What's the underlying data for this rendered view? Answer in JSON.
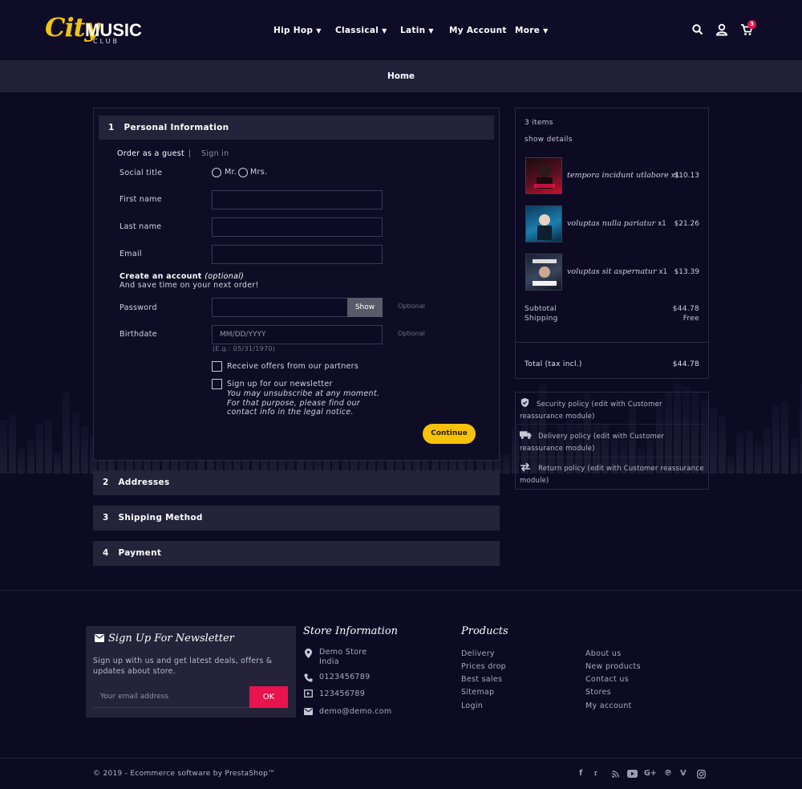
{
  "header": {
    "logo": {
      "city": "City",
      "music": "MUSIC",
      "club": "CLUB"
    },
    "nav": [
      {
        "label": "Hip Hop",
        "dropdown": true
      },
      {
        "label": "Classical",
        "dropdown": true
      },
      {
        "label": "Latin",
        "dropdown": true
      },
      {
        "label": "My Account",
        "dropdown": false
      },
      {
        "label": "More",
        "dropdown": true
      }
    ],
    "icons": [
      "search-icon",
      "user-icon",
      "cart-icon"
    ],
    "cart_count": "3",
    "accent_color": "#f6c30a",
    "badge_color": "#e8134f"
  },
  "breadcrumb": {
    "home": "Home"
  },
  "checkout": {
    "step1": {
      "number": "1",
      "title": "Personal Information",
      "guest_tab": "Order as a guest",
      "separator": "|",
      "signin_tab": "Sign in",
      "social_title_label": "Social title",
      "mr": "Mr.",
      "mrs": "Mrs.",
      "first_name_label": "First name",
      "last_name_label": "Last name",
      "email_label": "Email",
      "create_account": "Create an account",
      "create_optional": "(optional)",
      "save_time": "And save time on your next order!",
      "password_label": "Password",
      "show_button": "Show",
      "optional": "Optional",
      "birthdate_label": "Birthdate",
      "birthdate_placeholder": "MM/DD/YYYY",
      "birthdate_hint": "(E.g.: 05/31/1970)",
      "offers_label": "Receive offers from our partners",
      "newsletter_label": "Sign up for our newsletter",
      "newsletter_note": "You may unsubscribe at any moment. For that purpose, please find our contact info in the legal notice.",
      "continue_button": "Continue"
    },
    "steps": [
      {
        "number": "2",
        "title": "Addresses"
      },
      {
        "number": "3",
        "title": "Shipping Method"
      },
      {
        "number": "4",
        "title": "Payment"
      }
    ]
  },
  "summary": {
    "items_count": "3 items",
    "show_details": "show details",
    "products": [
      {
        "name": "tempora incidunt utlabore",
        "qty": "x1",
        "price": "$10.13"
      },
      {
        "name": "voluptas nulla pariatur",
        "qty": "x1",
        "price": "$21.26"
      },
      {
        "name": "voluptas sit aspernatur",
        "qty": "x1",
        "price": "$13.39"
      }
    ],
    "subtotal_label": "Subtotal",
    "subtotal_value": "$44.78",
    "shipping_label": "Shipping",
    "shipping_value": "Free",
    "total_label": "Total (tax incl.)",
    "total_value": "$44.78"
  },
  "reassurance": [
    {
      "icon": "shield-icon",
      "text": "Security policy (edit with Customer reassurance module)"
    },
    {
      "icon": "truck-icon",
      "text": "Delivery policy (edit with Customer reassurance module)"
    },
    {
      "icon": "swap-icon",
      "text": "Return policy (edit with Customer reassurance module)"
    }
  ],
  "footer": {
    "newsletter_title": "Sign Up For Newsletter",
    "newsletter_text": "Sign up with us and get latest deals, offers & updates about store.",
    "email_placeholder": "Your email address",
    "ok_button": "OK",
    "store_title": "Store Information",
    "store_name": "Demo Store",
    "store_country": "India",
    "phone": "0123456789",
    "fax": "123456789",
    "email": "demo@demo.com",
    "products_title": "Products",
    "products_links": [
      "Delivery",
      "Prices drop",
      "Best sales",
      "Sitemap",
      "Login"
    ],
    "company_links": [
      "About us",
      "New products",
      "Contact us",
      "Stores",
      "My account"
    ],
    "copyright": "© 2019 - Ecommerce software by PrestaShop™",
    "social": [
      "facebook-icon",
      "twitter-icon",
      "rss-icon",
      "youtube-icon",
      "googleplus-icon",
      "pinterest-icon",
      "vimeo-icon",
      "instagram-icon"
    ]
  }
}
